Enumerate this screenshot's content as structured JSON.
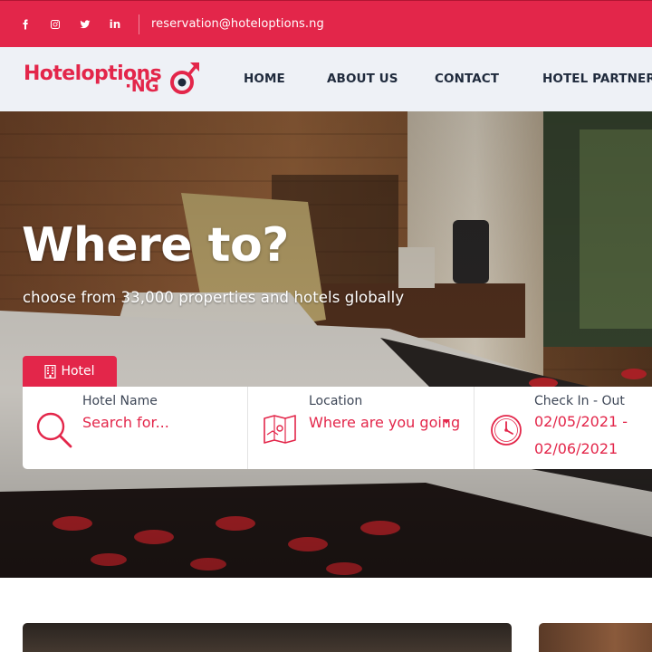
{
  "topbar": {
    "social": [
      {
        "name": "facebook-icon",
        "glyph": "f"
      },
      {
        "name": "instagram-icon",
        "glyph": ""
      },
      {
        "name": "twitter-icon",
        "glyph": ""
      },
      {
        "name": "linkedin-icon",
        "glyph": "in"
      }
    ],
    "email": "reservation@hoteloptions.ng",
    "bg_color": "#e3264a"
  },
  "header": {
    "logo_text": "Hoteloptions",
    "logo_suffix": "·NG",
    "nav": [
      {
        "label": "HOME"
      },
      {
        "label": "ABOUT US"
      },
      {
        "label": "CONTACT"
      },
      {
        "label": "HOTEL PARTNER"
      }
    ]
  },
  "hero": {
    "title": "Where to?",
    "subtitle": "choose from 33,000 properties and hotels globally",
    "tab_label": "Hotel",
    "search": {
      "hotel_name": {
        "label": "Hotel Name",
        "placeholder": "Search for...",
        "icon": "search-icon"
      },
      "location": {
        "label": "Location",
        "value": "Where are you going",
        "icon": "map-icon"
      },
      "dates": {
        "label": "Check In - Out",
        "check_in": "02/05/2021 -",
        "check_out": "02/06/2021",
        "icon": "clock-icon"
      }
    }
  },
  "colors": {
    "accent": "#e3264a",
    "nav_text": "#1f2a3c",
    "header_bg": "#eef1f6"
  }
}
